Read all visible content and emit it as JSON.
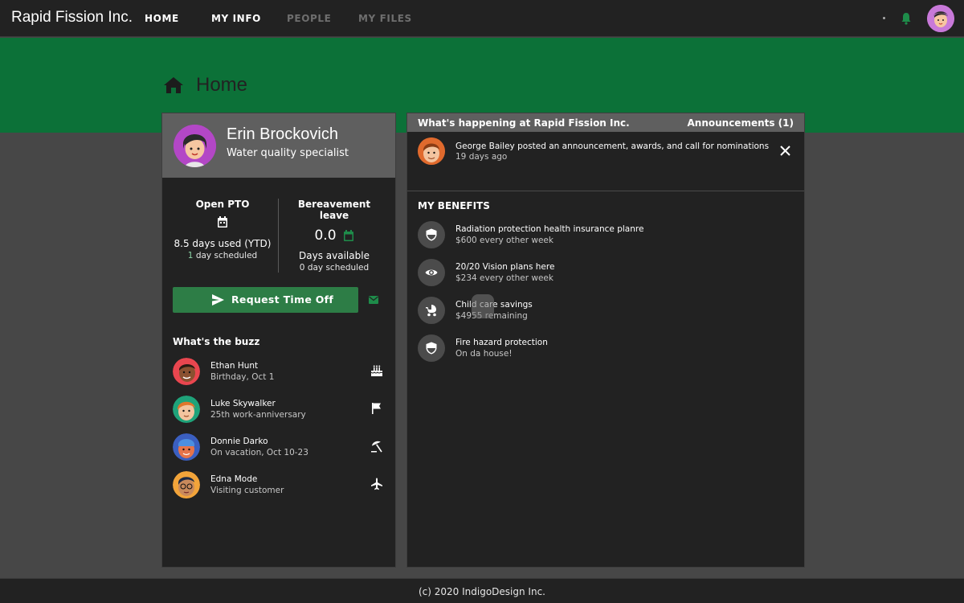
{
  "app": {
    "brand": "Rapid Fission Inc."
  },
  "nav": {
    "items": [
      {
        "label": "HOME"
      },
      {
        "label": "MY INFO"
      },
      {
        "label": "PEOPLE"
      },
      {
        "label": "MY FILES"
      }
    ]
  },
  "page": {
    "title": "Home",
    "icon": "home-icon"
  },
  "profile": {
    "name": "Erin Brockovich",
    "role": "Water quality specialist"
  },
  "pto": {
    "open": {
      "title": "Open PTO",
      "used": "8.5 days used (YTD)",
      "scheduled_count": "1",
      "scheduled_suffix": " day scheduled"
    },
    "bereavement": {
      "title": "Bereavement leave",
      "value": "0.0",
      "available": "Days available",
      "scheduled": "0 day scheduled"
    }
  },
  "request_button": {
    "label": "Request Time Off"
  },
  "buzz": {
    "title": "What's the buzz",
    "items": [
      {
        "name": "Ethan Hunt",
        "detail": "Birthday, Oct 1",
        "icon": "cake-icon"
      },
      {
        "name": "Luke Skywalker",
        "detail": "25th work-anniversary",
        "icon": "flag-icon"
      },
      {
        "name": "Donnie Darko",
        "detail": "On vacation, Oct 10-23",
        "icon": "beach-umbrella-icon"
      },
      {
        "name": "Edna Mode",
        "detail": "Visiting customer",
        "icon": "airplane-icon"
      }
    ]
  },
  "happening": {
    "title": "What's happening at Rapid Fission Inc.",
    "announcements_label": "Announcements (1)",
    "announcement": {
      "text": "George Bailey posted an announcement, awards, and call for nominations",
      "time": "19 days ago"
    }
  },
  "benefits": {
    "title": "MY BENEFITS",
    "items": [
      {
        "name": "Radiation protection health insurance planre",
        "detail": "$600 every other week",
        "icon": "shield-icon"
      },
      {
        "name": "20/20 Vision plans here",
        "detail": "$234 every other week",
        "icon": "eye-icon"
      },
      {
        "name": "Child care savings",
        "detail": "$4955 remaining",
        "icon": "stroller-icon"
      },
      {
        "name": "Fire hazard protection",
        "detail": "On da house!",
        "icon": "shield-icon"
      }
    ]
  },
  "footer": {
    "text": "(c) 2020 IndigoDesign Inc."
  },
  "colors": {
    "brand_green": "#0c7138",
    "button_green": "#2d7d46",
    "header_grey": "#5f5f5f",
    "panel_dark": "#222222",
    "background": "#474747"
  }
}
